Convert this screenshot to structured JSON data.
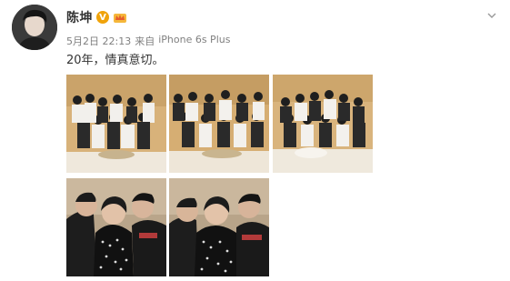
{
  "author": {
    "name": "陈坤",
    "verified_badge": "V",
    "member_badge": "crown-icon"
  },
  "meta": {
    "date": "5月2日 22:13",
    "source_prefix": "来自",
    "source_device": "iPhone 6s Plus"
  },
  "post": {
    "text": "20年，情真意切。"
  },
  "photos": {
    "count": 5,
    "layout": "3+2 grid"
  },
  "colors": {
    "text_primary": "#333333",
    "text_meta": "#808080",
    "badge_v": "#f0a30a"
  }
}
